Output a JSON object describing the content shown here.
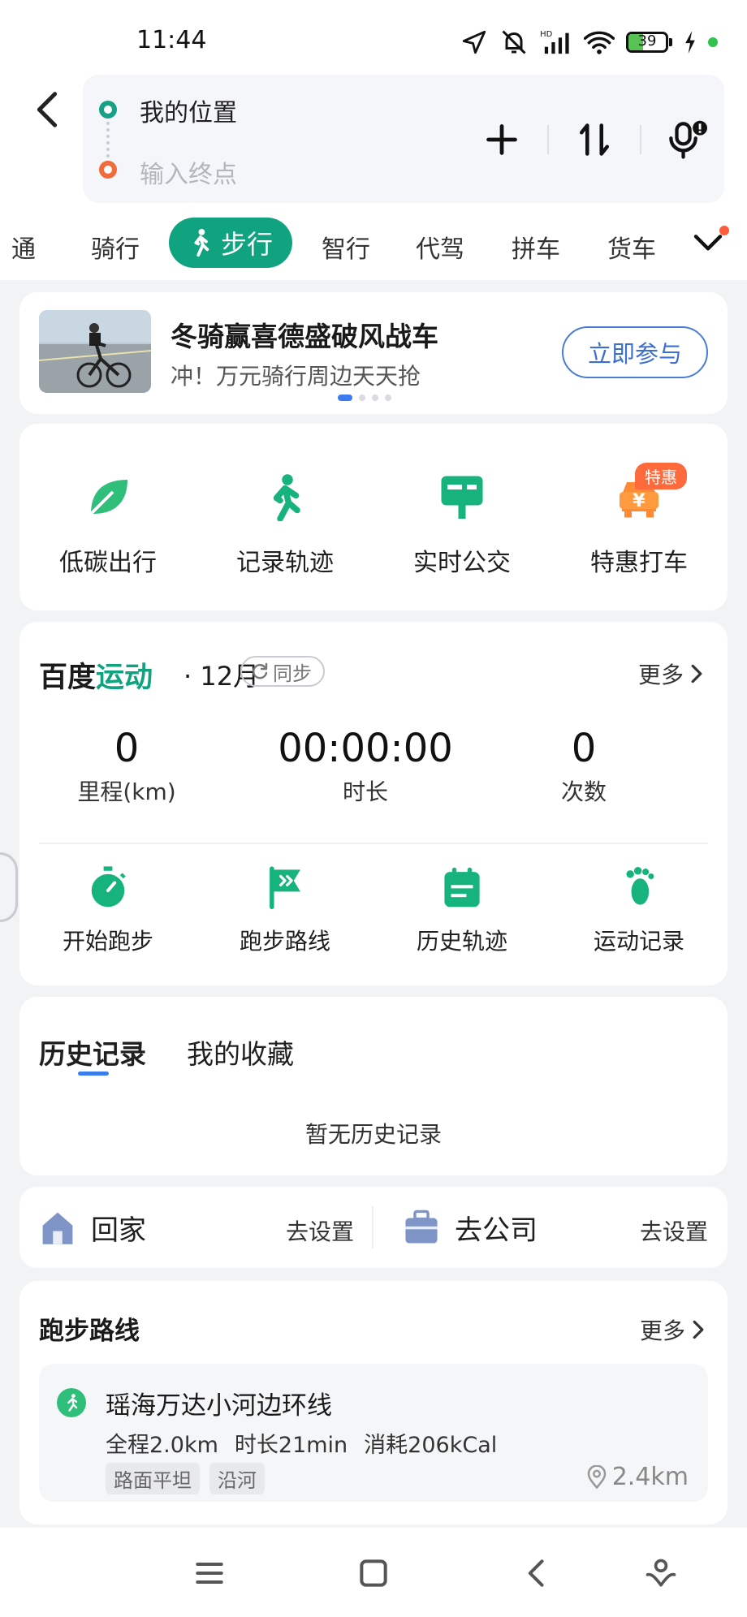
{
  "status_bar": {
    "time": "11:44",
    "battery": "39",
    "battery_level": 0.39,
    "network": "HD"
  },
  "route": {
    "start": "我的位置",
    "end_placeholder": "输入终点"
  },
  "modes": {
    "items": [
      "通",
      "骑行",
      "步行",
      "智行",
      "代驾",
      "拼车",
      "货车"
    ],
    "active": "步行"
  },
  "banner": {
    "title": "冬骑赢喜德盛破风战车",
    "subtitle": "冲！万元骑行周边天天抢",
    "button": "立即参与"
  },
  "quick_actions": [
    {
      "label": "低碳出行",
      "icon": "leaf-icon",
      "color": "#2fbf7a"
    },
    {
      "label": "记录轨迹",
      "icon": "walker-icon",
      "color": "#16b37c"
    },
    {
      "label": "实时公交",
      "icon": "bus-stop-icon",
      "color": "#16b37c"
    },
    {
      "label": "特惠打车",
      "icon": "taxi-yen-icon",
      "color": "#ff8a34"
    }
  ],
  "quick_badge": "特惠",
  "sport": {
    "title_a": "百度",
    "title_b": "运动",
    "month": "· 12月",
    "sync": "同步",
    "more": "更多",
    "stats": [
      {
        "value": "0",
        "label": "里程(km)"
      },
      {
        "value": "00:00:00",
        "label": "时长"
      },
      {
        "value": "0",
        "label": "次数"
      }
    ],
    "actions": [
      {
        "label": "开始跑步",
        "icon": "stopwatch-icon"
      },
      {
        "label": "跑步路线",
        "icon": "route-flag-icon"
      },
      {
        "label": "历史轨迹",
        "icon": "calendar-icon"
      },
      {
        "label": "运动记录",
        "icon": "footprint-icon"
      }
    ]
  },
  "history": {
    "tabs": [
      "历史记录",
      "我的收藏"
    ],
    "empty": "暂无历史记录"
  },
  "shortcuts": {
    "home": "回家",
    "home_set": "去设置",
    "company": "去公司",
    "company_set": "去设置"
  },
  "run_route": {
    "title": "跑步路线",
    "more": "更多",
    "name": "瑶海万达小河边环线",
    "distance": "全程2.0km",
    "duration": "时长21min",
    "calories": "消耗206kCal",
    "tags": [
      "路面平坦",
      "沿河"
    ],
    "away": "2.4km"
  },
  "colors": {
    "accent": "#10a37f",
    "link": "#3b6fd1",
    "warn": "#ff6a3d"
  }
}
